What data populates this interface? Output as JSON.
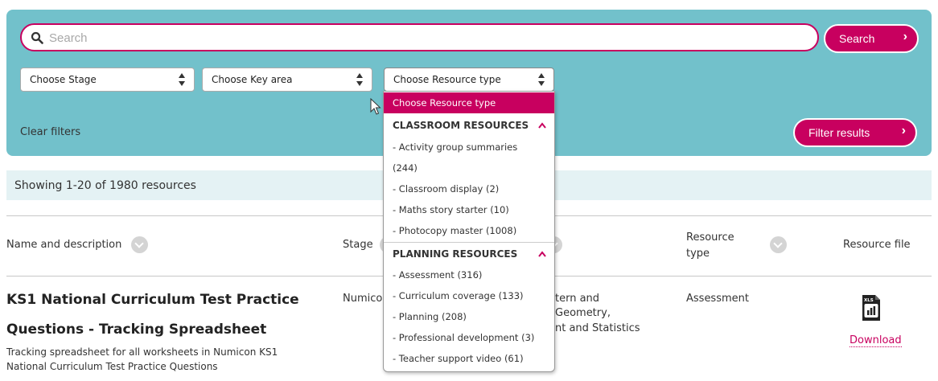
{
  "search": {
    "placeholder": "Search",
    "button_label": "Search",
    "button_chevron": "›"
  },
  "filters": {
    "stage": "Choose Stage",
    "key_area": "Choose Key area",
    "resource_type": "Choose Resource type",
    "clear_label": "Clear filters",
    "filter_button_label": "Filter results"
  },
  "dropdown": {
    "selected": "Choose Resource type",
    "group1": "CLASSROOM RESOURCES",
    "items1": [
      "- Activity group summaries",
      "(244)",
      "- Classroom display (2)",
      "- Maths story starter (10)",
      "- Photocopy master (1008)"
    ],
    "group2": "PLANNING RESOURCES",
    "items2": [
      "- Assessment (316)",
      "- Curriculum coverage (133)",
      "- Planning (208)",
      "- Professional development (3)",
      "- Teacher support video (61)"
    ],
    "caret": "^"
  },
  "results": {
    "summary": "Showing 1-20 of 1980 resources"
  },
  "table": {
    "headers": {
      "name": "Name and description",
      "stage": "Stage",
      "type_line1": "Resource",
      "type_line2": "type",
      "file": "Resource file"
    },
    "row": {
      "title_line1": "KS1 National Curriculum Test Practice",
      "title_line2": "Questions - Tracking Spreadsheet",
      "desc_line1": "Tracking spreadsheet for all worksheets in Numicon KS1",
      "desc_line2": "National Curriculum Test Practice Questions",
      "stage": "Numico",
      "key_area_line1": "tern and",
      "key_area_line2": "Geometry,",
      "key_area_line3": "nt and Statistics",
      "resource_type": "Assessment",
      "file_badge": "XLS",
      "download_label": "Download"
    }
  },
  "colors": {
    "accent": "#c8005f",
    "panel": "#72c1cb",
    "results_bar": "#e4f2f4"
  },
  "icons": [
    "search-icon",
    "chevron-right-icon",
    "select-arrows-icon",
    "chevron-up-icon",
    "sort-chevron-icon",
    "xls-file-icon",
    "mouse-pointer-icon"
  ]
}
